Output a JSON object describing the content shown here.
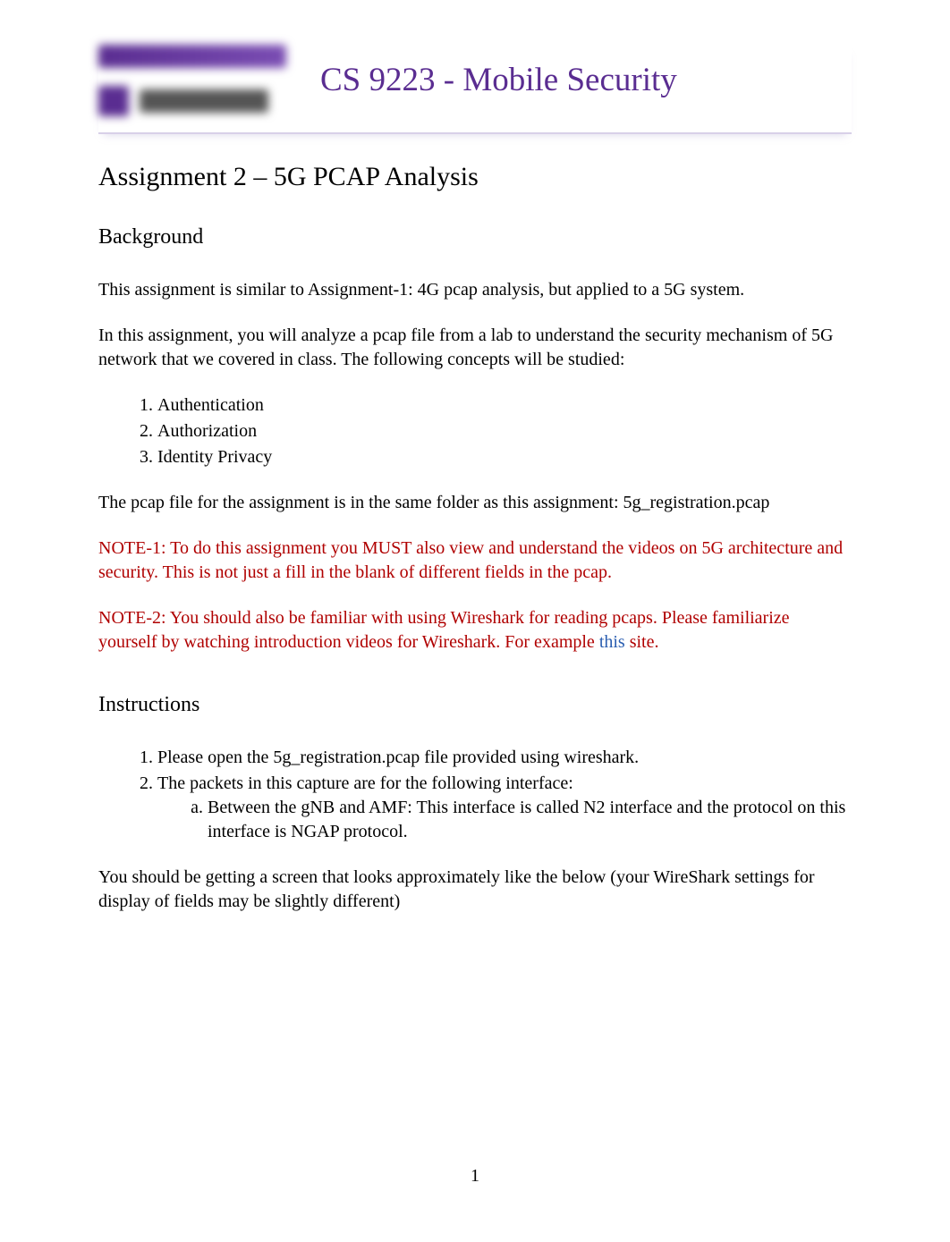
{
  "header": {
    "course_title": "CS 9223 - Mobile Security"
  },
  "assignment_title": "Assignment 2 – 5G PCAP Analysis",
  "sections": {
    "background": {
      "heading": "Background",
      "para1": "This assignment is similar to Assignment-1: 4G pcap analysis, but applied to a 5G system.",
      "para2": "In this assignment, you will analyze a pcap file from a lab to understand the security mechanism of 5G network that we covered in class. The following concepts will be studied:",
      "concepts": [
        "Authentication",
        "Authorization",
        "Identity Privacy"
      ],
      "para3": "The pcap file for the assignment is in the same folder as this assignment: 5g_registration.pcap",
      "note1": "NOTE-1: To do this assignment you MUST also view and understand the videos on 5G architecture and security. This is not just a fill in the blank of different fields in the pcap.",
      "note2_part1": "NOTE-2: You should also be familiar with using Wireshark for reading pcaps. Please familiarize yourself by watching introduction videos for Wireshark. For example ",
      "note2_link": "this",
      "note2_part2": " site."
    },
    "instructions": {
      "heading": "Instructions",
      "item1": "Please open the 5g_registration.pcap file provided using wireshark.",
      "item2": "The packets in this capture are for the following interface:",
      "item2a": "Between the gNB and AMF: This interface is called N2 interface and the protocol on this interface is NGAP protocol.",
      "para_after": "You should be getting a screen that looks approximately like the below (your WireShark settings for display of fields may be slightly different)"
    }
  },
  "page_number": "1"
}
